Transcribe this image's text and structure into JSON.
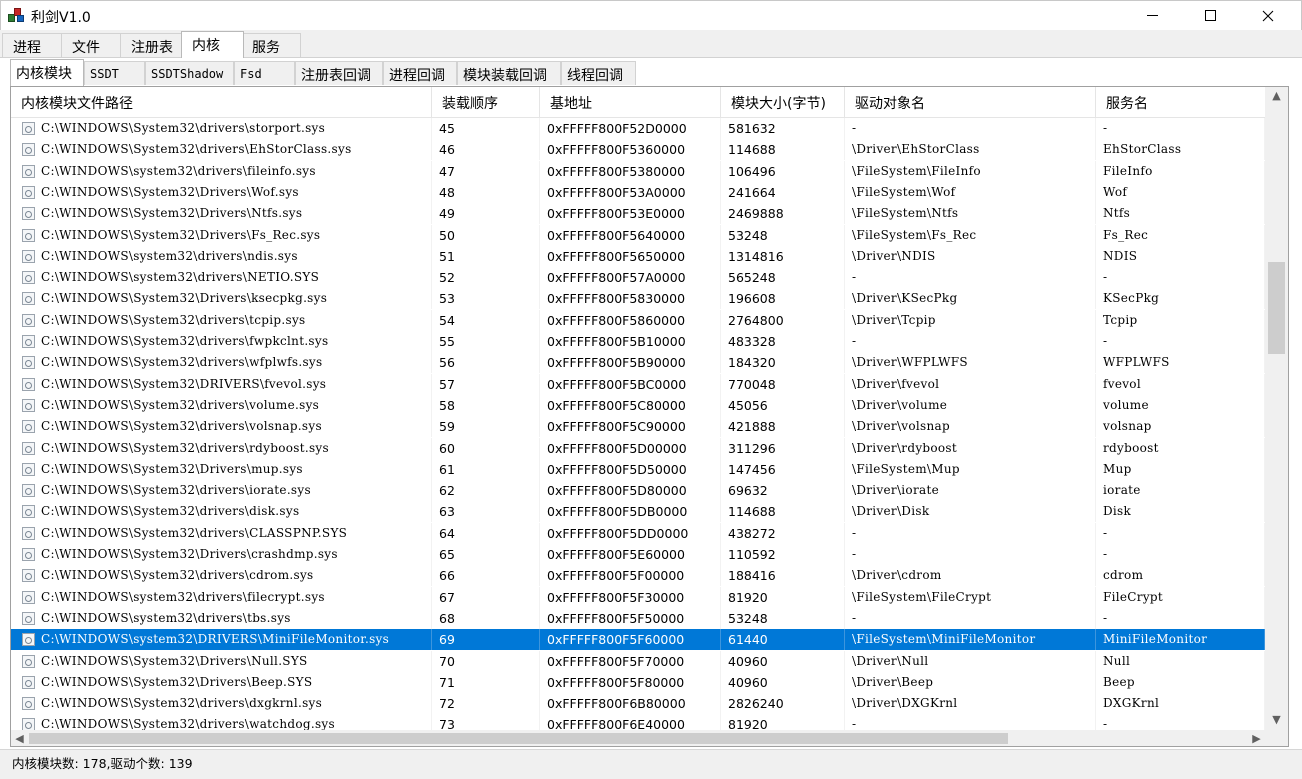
{
  "window": {
    "title": "利剑V1.0"
  },
  "main_tabs": [
    "进程",
    "文件",
    "注册表",
    "内核",
    "服务"
  ],
  "main_tab_active": "内核",
  "sub_tabs": [
    "内核模块",
    "SSDT",
    "SSDTShadow",
    "Fsd",
    "注册表回调",
    "进程回调",
    "模块装载回调",
    "线程回调"
  ],
  "sub_tab_active": "内核模块",
  "table": {
    "columns": [
      "内核模块文件路径",
      "装载顺序",
      "基地址",
      "模块大小(字节)",
      "驱动对象名",
      "服务名"
    ],
    "rows": [
      [
        "C:\\WINDOWS\\System32\\drivers\\storport.sys",
        "45",
        "0xFFFFF800F52D0000",
        "581632",
        "-",
        "-"
      ],
      [
        "C:\\WINDOWS\\System32\\drivers\\EhStorClass.sys",
        "46",
        "0xFFFFF800F5360000",
        "114688",
        "\\Driver\\EhStorClass",
        "EhStorClass"
      ],
      [
        "C:\\WINDOWS\\system32\\drivers\\fileinfo.sys",
        "47",
        "0xFFFFF800F5380000",
        "106496",
        "\\FileSystem\\FileInfo",
        "FileInfo"
      ],
      [
        "C:\\WINDOWS\\System32\\Drivers\\Wof.sys",
        "48",
        "0xFFFFF800F53A0000",
        "241664",
        "\\FileSystem\\Wof",
        "Wof"
      ],
      [
        "C:\\WINDOWS\\System32\\Drivers\\Ntfs.sys",
        "49",
        "0xFFFFF800F53E0000",
        "2469888",
        "\\FileSystem\\Ntfs",
        "Ntfs"
      ],
      [
        "C:\\WINDOWS\\System32\\Drivers\\Fs_Rec.sys",
        "50",
        "0xFFFFF800F5640000",
        "53248",
        "\\FileSystem\\Fs_Rec",
        "Fs_Rec"
      ],
      [
        "C:\\WINDOWS\\system32\\drivers\\ndis.sys",
        "51",
        "0xFFFFF800F5650000",
        "1314816",
        "\\Driver\\NDIS",
        "NDIS"
      ],
      [
        "C:\\WINDOWS\\system32\\drivers\\NETIO.SYS",
        "52",
        "0xFFFFF800F57A0000",
        "565248",
        "-",
        "-"
      ],
      [
        "C:\\WINDOWS\\System32\\Drivers\\ksecpkg.sys",
        "53",
        "0xFFFFF800F5830000",
        "196608",
        "\\Driver\\KSecPkg",
        "KSecPkg"
      ],
      [
        "C:\\WINDOWS\\System32\\drivers\\tcpip.sys",
        "54",
        "0xFFFFF800F5860000",
        "2764800",
        "\\Driver\\Tcpip",
        "Tcpip"
      ],
      [
        "C:\\WINDOWS\\System32\\drivers\\fwpkclnt.sys",
        "55",
        "0xFFFFF800F5B10000",
        "483328",
        "-",
        "-"
      ],
      [
        "C:\\WINDOWS\\System32\\drivers\\wfplwfs.sys",
        "56",
        "0xFFFFF800F5B90000",
        "184320",
        "\\Driver\\WFPLWFS",
        "WFPLWFS"
      ],
      [
        "C:\\WINDOWS\\System32\\DRIVERS\\fvevol.sys",
        "57",
        "0xFFFFF800F5BC0000",
        "770048",
        "\\Driver\\fvevol",
        "fvevol"
      ],
      [
        "C:\\WINDOWS\\System32\\drivers\\volume.sys",
        "58",
        "0xFFFFF800F5C80000",
        "45056",
        "\\Driver\\volume",
        "volume"
      ],
      [
        "C:\\WINDOWS\\System32\\drivers\\volsnap.sys",
        "59",
        "0xFFFFF800F5C90000",
        "421888",
        "\\Driver\\volsnap",
        "volsnap"
      ],
      [
        "C:\\WINDOWS\\System32\\drivers\\rdyboost.sys",
        "60",
        "0xFFFFF800F5D00000",
        "311296",
        "\\Driver\\rdyboost",
        "rdyboost"
      ],
      [
        "C:\\WINDOWS\\System32\\Drivers\\mup.sys",
        "61",
        "0xFFFFF800F5D50000",
        "147456",
        "\\FileSystem\\Mup",
        "Mup"
      ],
      [
        "C:\\WINDOWS\\System32\\drivers\\iorate.sys",
        "62",
        "0xFFFFF800F5D80000",
        "69632",
        "\\Driver\\iorate",
        "iorate"
      ],
      [
        "C:\\WINDOWS\\System32\\drivers\\disk.sys",
        "63",
        "0xFFFFF800F5DB0000",
        "114688",
        "\\Driver\\Disk",
        "Disk"
      ],
      [
        "C:\\WINDOWS\\System32\\drivers\\CLASSPNP.SYS",
        "64",
        "0xFFFFF800F5DD0000",
        "438272",
        "-",
        "-"
      ],
      [
        "C:\\WINDOWS\\System32\\Drivers\\crashdmp.sys",
        "65",
        "0xFFFFF800F5E60000",
        "110592",
        "-",
        "-"
      ],
      [
        "C:\\WINDOWS\\System32\\drivers\\cdrom.sys",
        "66",
        "0xFFFFF800F5F00000",
        "188416",
        "\\Driver\\cdrom",
        "cdrom"
      ],
      [
        "C:\\WINDOWS\\system32\\drivers\\filecrypt.sys",
        "67",
        "0xFFFFF800F5F30000",
        "81920",
        "\\FileSystem\\FileCrypt",
        "FileCrypt"
      ],
      [
        "C:\\WINDOWS\\system32\\drivers\\tbs.sys",
        "68",
        "0xFFFFF800F5F50000",
        "53248",
        "-",
        "-"
      ],
      [
        "C:\\WINDOWS\\system32\\DRIVERS\\MiniFileMonitor.sys",
        "69",
        "0xFFFFF800F5F60000",
        "61440",
        "\\FileSystem\\MiniFileMonitor",
        "MiniFileMonitor"
      ],
      [
        "C:\\WINDOWS\\System32\\Drivers\\Null.SYS",
        "70",
        "0xFFFFF800F5F70000",
        "40960",
        "\\Driver\\Null",
        "Null"
      ],
      [
        "C:\\WINDOWS\\System32\\Drivers\\Beep.SYS",
        "71",
        "0xFFFFF800F5F80000",
        "40960",
        "\\Driver\\Beep",
        "Beep"
      ],
      [
        "C:\\WINDOWS\\System32\\drivers\\dxgkrnl.sys",
        "72",
        "0xFFFFF800F6B80000",
        "2826240",
        "\\Driver\\DXGKrnl",
        "DXGKrnl"
      ],
      [
        "C:\\WINDOWS\\System32\\drivers\\watchdog.sys",
        "73",
        "0xFFFFF800F6E40000",
        "81920",
        "-",
        "-"
      ]
    ],
    "selected_row": 24
  },
  "status": {
    "text": "内核模块数: 178,驱动个数: 139"
  },
  "colors": {
    "selection": "#0078d7",
    "chrome": "#f0f0f0"
  }
}
